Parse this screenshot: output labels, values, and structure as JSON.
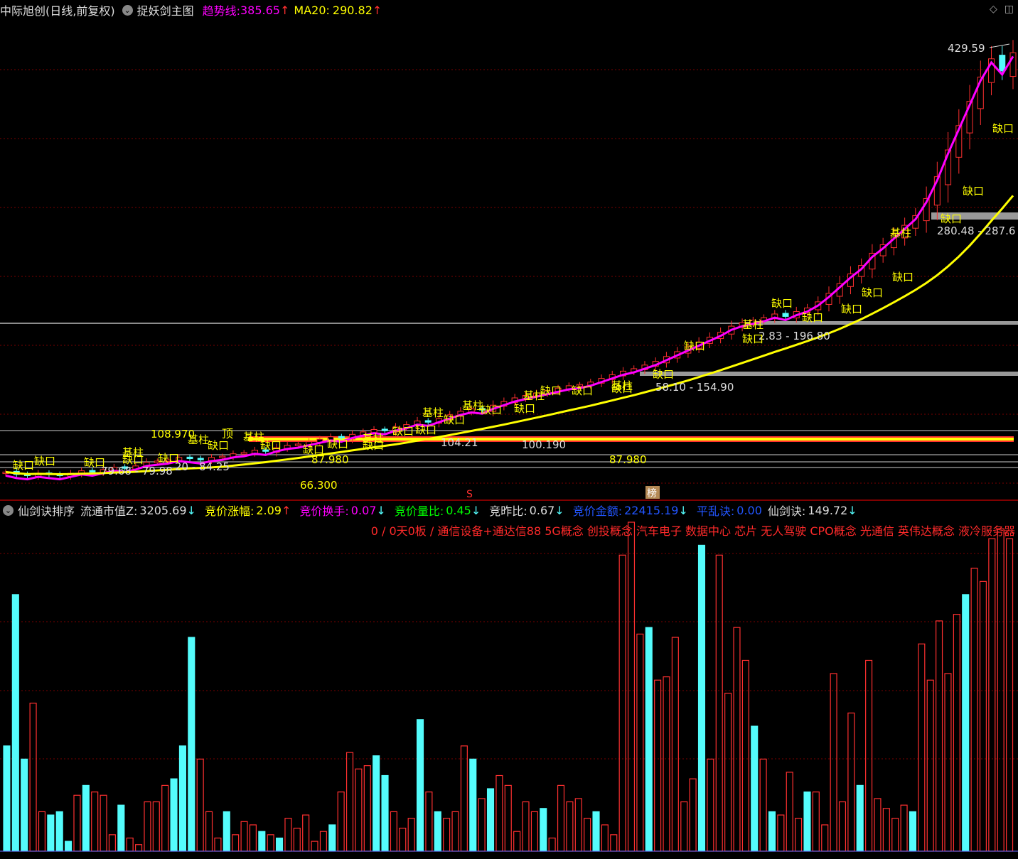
{
  "header": {
    "title": "中际旭创(日线,前复权)",
    "indicator_name": "捉妖剑主图",
    "trend_label": "趋势线:",
    "trend_value": "385.65",
    "ma20_label": "MA20:",
    "ma20_value": "290.82",
    "arrow_up": "↑",
    "arrow_down": "↓"
  },
  "sub_header": {
    "name": "仙剑诀排序",
    "float_cap_label": "流通市值Z:",
    "float_cap_value": "3205.69",
    "bid_change_label": "竞价涨幅:",
    "bid_change_value": "2.09",
    "bid_turnover_label": "竞价换手:",
    "bid_turnover_value": "0.07",
    "bid_volratio_label": "竞价量比:",
    "bid_volratio_value": "0.45",
    "bid_prev_label": "竞昨比:",
    "bid_prev_value": "0.67",
    "bid_amount_label": "竞价金额:",
    "bid_amount_value": "22415.19",
    "chaos_label": "平乱诀:",
    "chaos_value": "0.00",
    "xjj_label": "仙剑诀:",
    "xjj_value": "149.72"
  },
  "concepts": "0 / 0天0板 / 通信设备+通达信88 5G概念 创投概念 汽车电子 数据中心 芯片 无人驾驶 CPO概念 光通信 英伟达概念 液冷服务器",
  "annotations": {
    "high": "429.59",
    "zone1": "280.48 - 287.6",
    "zone2": "2.83 - 196.80",
    "zone3": "58.10 - 154.90",
    "level_a": "108.970",
    "level_b": "104.21",
    "level_c": "100.190",
    "level_d": "87.980",
    "level_e": "87.980",
    "level_f": "66.300",
    "range_a": "79.68 - 79.98",
    "range_b": "20 - 84.25",
    "gap": "缺口",
    "pillar": "基柱",
    "top": "顶",
    "marker_s": "S",
    "marker_rank": "榜"
  },
  "colors": {
    "up": "#ff3030",
    "down": "#54fcfc",
    "trend": "#ff00ff",
    "ma20": "#ffff00",
    "grid": "#7a0000",
    "gap_label": "#ffff00"
  },
  "chart_data": [
    {
      "type": "candlestick",
      "title": "中际旭创(日线,前复权)",
      "series": [
        {
          "name": "趋势线",
          "value": 385.65
        },
        {
          "name": "MA20",
          "value": 290.82
        }
      ],
      "high_marker": 429.59,
      "close_approx": [
        75,
        73,
        72,
        74,
        73,
        72,
        74,
        76,
        75,
        77,
        79,
        78,
        80,
        83,
        84,
        85,
        87,
        86,
        85,
        87,
        88,
        90,
        91,
        93,
        92,
        95,
        97,
        98,
        100,
        102,
        104,
        103,
        106,
        108,
        110,
        109,
        112,
        114,
        117,
        116,
        119,
        122,
        125,
        127,
        126,
        130,
        133,
        136,
        138,
        140,
        142,
        144,
        146,
        147,
        149,
        152,
        155,
        158,
        160,
        163,
        166,
        170,
        174,
        178,
        182,
        186,
        190,
        195,
        198,
        200,
        202,
        205,
        203,
        207,
        210,
        215,
        222,
        230,
        238,
        245,
        255,
        262,
        270,
        278,
        286,
        300,
        318,
        340,
        360,
        380,
        400,
        415,
        405,
        420
      ]
    },
    {
      "type": "bar",
      "title": "仙剑诀排序",
      "values": [
        32,
        78,
        28,
        45,
        12,
        11,
        12,
        3,
        17,
        20,
        18,
        17,
        5,
        14,
        4,
        2,
        15,
        15,
        20,
        22,
        32,
        65,
        28,
        12,
        4,
        12,
        5,
        9,
        8,
        6,
        5,
        4,
        10,
        7,
        11,
        3,
        6,
        8,
        18,
        30,
        25,
        26,
        29,
        23,
        12,
        7,
        10,
        40,
        18,
        12,
        10,
        12,
        32,
        28,
        16,
        19,
        23,
        20,
        6,
        15,
        12,
        13,
        4,
        20,
        15,
        16,
        10,
        12,
        8,
        5,
        90,
        100,
        66,
        68,
        52,
        53,
        65,
        15,
        22,
        93,
        28,
        90,
        48,
        68,
        58,
        38,
        28,
        12,
        11,
        24,
        10,
        18,
        18,
        8,
        54,
        15,
        42,
        20,
        58,
        16,
        13,
        10,
        14,
        12,
        63,
        52,
        70,
        54,
        72,
        78,
        86,
        82,
        95,
        98,
        95
      ]
    }
  ]
}
